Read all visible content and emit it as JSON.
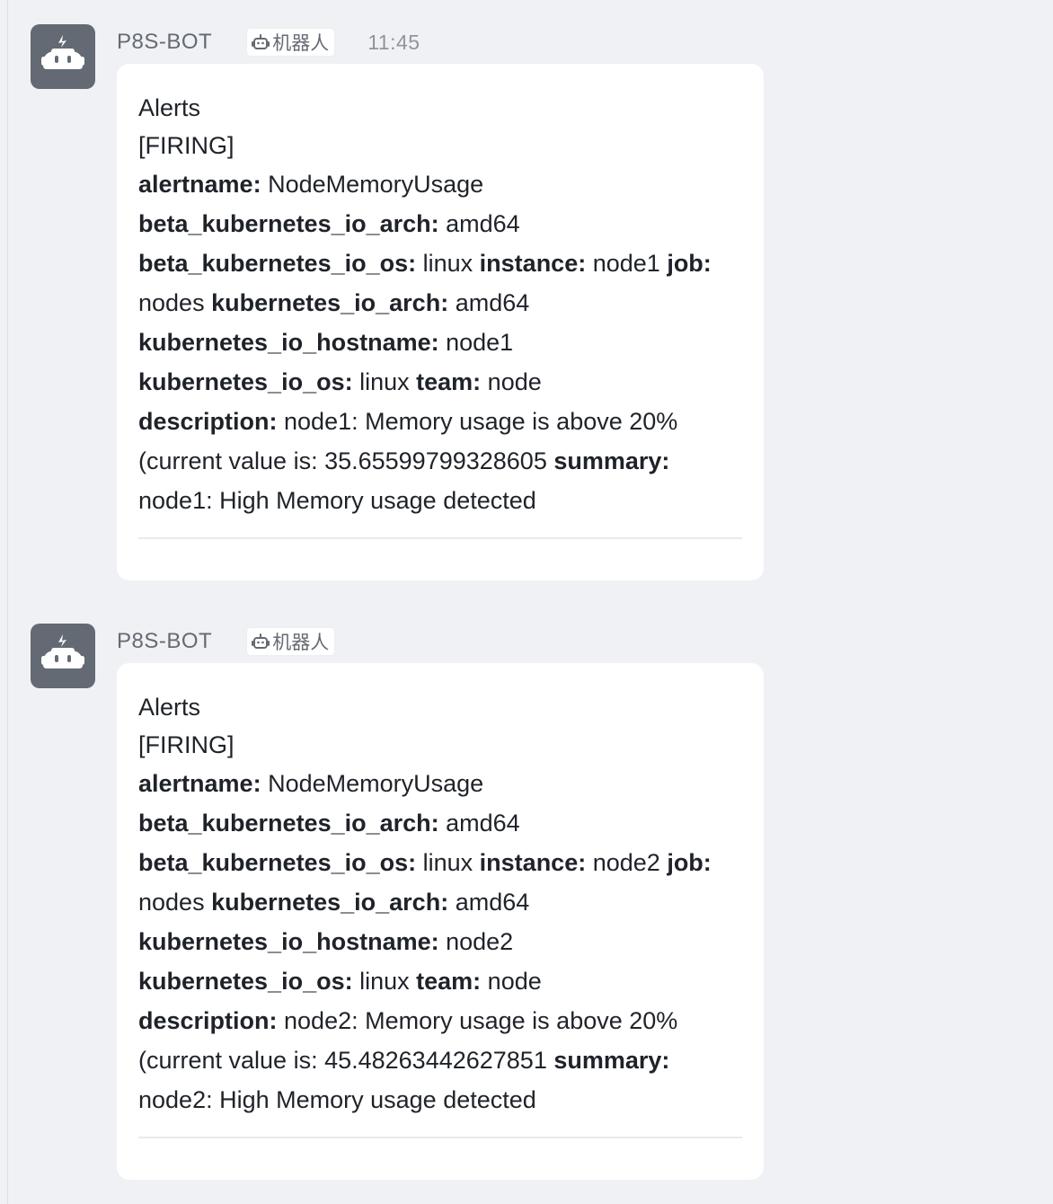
{
  "app": {
    "accent": "#646a73",
    "background": "#f0f1f4"
  },
  "messages": [
    {
      "sender": "P8S-BOT",
      "badge_label": "机器人",
      "badge_icon": "robot-icon",
      "timestamp": "11:45",
      "avatar_icon": "robot-icon",
      "title": "Alerts",
      "status": "[FIRING]",
      "fields": {
        "alertname_key": "alertname:",
        "alertname_val": " NodeMemoryUsage",
        "beta_arch_key": "beta_kubernetes_io_arch:",
        "beta_arch_val": " amd64",
        "beta_os_key": "beta_kubernetes_io_os:",
        "beta_os_val": " linux ",
        "instance_key": "instance:",
        "instance_val": " node1 ",
        "job_key": "job:",
        "job_val": "nodes ",
        "arch_key": "kubernetes_io_arch:",
        "arch_val": " amd64",
        "hostname_key": "kubernetes_io_hostname:",
        "hostname_val": " node1",
        "os_key": "kubernetes_io_os:",
        "os_val": " linux ",
        "team_key": "team:",
        "team_val": " node",
        "description_key": "description:",
        "description_val": " node1: Memory usage is above 20% (current value is: 35.65599799328605 ",
        "summary_key": "summary:",
        "summary_val": "node1: High Memory usage detected"
      }
    },
    {
      "sender": "P8S-BOT",
      "badge_label": "机器人",
      "badge_icon": "robot-icon",
      "timestamp": "",
      "avatar_icon": "robot-icon",
      "title": "Alerts",
      "status": "[FIRING]",
      "fields": {
        "alertname_key": "alertname:",
        "alertname_val": " NodeMemoryUsage",
        "beta_arch_key": "beta_kubernetes_io_arch:",
        "beta_arch_val": " amd64",
        "beta_os_key": "beta_kubernetes_io_os:",
        "beta_os_val": " linux ",
        "instance_key": "instance:",
        "instance_val": " node2 ",
        "job_key": "job:",
        "job_val": "nodes ",
        "arch_key": "kubernetes_io_arch:",
        "arch_val": " amd64",
        "hostname_key": "kubernetes_io_hostname:",
        "hostname_val": " node2",
        "os_key": "kubernetes_io_os:",
        "os_val": " linux ",
        "team_key": "team:",
        "team_val": " node",
        "description_key": "description:",
        "description_val": " node2: Memory usage is above 20% (current value is: 45.48263442627851 ",
        "summary_key": "summary:",
        "summary_val": "node2: High Memory usage detected"
      }
    }
  ]
}
